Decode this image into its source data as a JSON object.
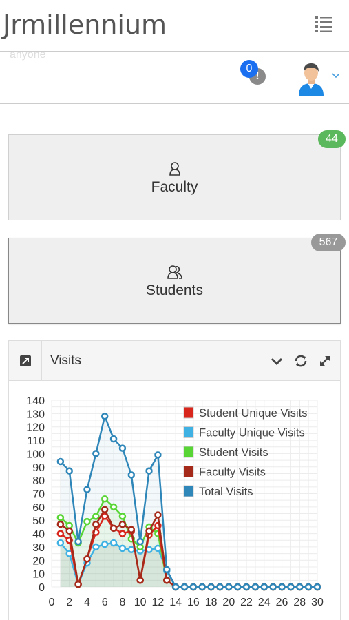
{
  "header": {
    "brand": "Jrmillennium",
    "ghost_text": "anyone"
  },
  "notifications": {
    "count": "0",
    "alert_glyph": "!"
  },
  "tiles": [
    {
      "label": "Faculty",
      "count": "44",
      "icon": "user-icon"
    },
    {
      "label": "Students",
      "count": "567",
      "icon": "users-icon"
    }
  ],
  "panel": {
    "title": "Visits"
  },
  "colors": {
    "green_badge": "#5cb85c",
    "grey_badge": "#999999",
    "notif_blue": "#1a6ff0"
  },
  "chart_data": {
    "type": "line",
    "x": [
      1,
      2,
      3,
      4,
      5,
      6,
      7,
      8,
      9,
      10,
      11,
      12,
      13,
      14,
      15,
      16,
      17,
      18,
      19,
      20,
      21,
      22,
      23,
      24,
      25,
      26,
      27,
      28,
      29,
      30
    ],
    "xticks": [
      0,
      2,
      4,
      6,
      8,
      10,
      12,
      14,
      16,
      18,
      20,
      22,
      24,
      26,
      28,
      30
    ],
    "yticks": [
      0,
      10,
      20,
      30,
      40,
      50,
      60,
      70,
      80,
      90,
      100,
      110,
      120,
      130,
      140
    ],
    "xlim": [
      0,
      30
    ],
    "ylim": [
      0,
      140
    ],
    "grid": true,
    "legend_position": "top-right",
    "series": [
      {
        "name": "Student Unique Visits",
        "color": "#d9261c",
        "values": [
          40,
          35,
          2,
          21,
          41,
          53,
          44,
          40,
          42,
          5,
          39,
          46,
          5,
          0,
          0,
          0,
          0,
          0,
          0,
          0,
          0,
          0,
          0,
          0,
          0,
          0,
          0,
          0,
          0,
          0
        ]
      },
      {
        "name": "Faculty Unique Visits",
        "color": "#3fb1e3",
        "values": [
          33,
          25,
          2,
          18,
          30,
          32,
          33,
          29,
          28,
          27,
          28,
          29,
          12,
          0,
          0,
          0,
          0,
          0,
          0,
          0,
          0,
          0,
          0,
          0,
          0,
          0,
          0,
          0,
          0,
          0
        ]
      },
      {
        "name": "Student Visits",
        "color": "#59d636",
        "values": [
          52,
          46,
          33,
          49,
          53,
          66,
          60,
          53,
          36,
          30,
          45,
          40,
          5,
          0,
          0,
          0,
          0,
          0,
          0,
          0,
          0,
          0,
          0,
          0,
          0,
          0,
          0,
          0,
          0,
          0
        ]
      },
      {
        "name": "Faculty Visits",
        "color": "#a52a1a",
        "values": [
          47,
          42,
          2,
          21,
          47,
          58,
          44,
          47,
          43,
          5,
          42,
          54,
          5,
          0,
          0,
          0,
          0,
          0,
          0,
          0,
          0,
          0,
          0,
          0,
          0,
          0,
          0,
          0,
          0,
          0
        ]
      },
      {
        "name": "Total Visits",
        "color": "#2f86b8",
        "values": [
          94,
          87,
          34,
          73,
          100,
          128,
          111,
          104,
          84,
          34,
          87,
          99,
          13,
          0,
          0,
          0,
          0,
          0,
          0,
          0,
          0,
          0,
          0,
          0,
          0,
          0,
          0,
          0,
          0,
          0
        ]
      }
    ]
  }
}
